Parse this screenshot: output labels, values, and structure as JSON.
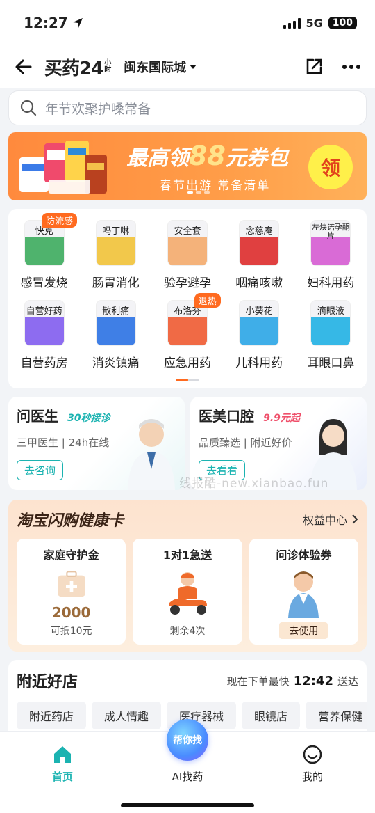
{
  "status": {
    "time": "12:27",
    "network": "5G",
    "battery": "100"
  },
  "nav": {
    "brand": "买药24",
    "brand_sub": "小时",
    "location": "闽东国际城"
  },
  "search": {
    "placeholder": "年节欢聚护嗓常备"
  },
  "banner": {
    "title_prefix": "最高领",
    "title_amount": "88",
    "title_suffix": "元券包",
    "subtitle": "春节出游 常备清单",
    "claim_label": "领"
  },
  "categories": [
    {
      "label": "感冒发烧",
      "icon_text": "快克",
      "tag": "防流感",
      "color": "#4fb36d"
    },
    {
      "label": "肠胃消化",
      "icon_text": "吗丁啉",
      "tag": "",
      "color": "#f2c84b"
    },
    {
      "label": "验孕避孕",
      "icon_text": "安全套",
      "tag": "",
      "color": "#f4b27a"
    },
    {
      "label": "咽痛咳嗽",
      "icon_text": "念慈庵",
      "tag": "",
      "color": "#e04040"
    },
    {
      "label": "妇科用药",
      "icon_text": "左炔诺孕酮片",
      "tag": "",
      "color": "#d96bd6"
    },
    {
      "label": "自营药房",
      "icon_text": "自营好药",
      "tag": "",
      "color": "#8d6cf0"
    },
    {
      "label": "消炎镇痛",
      "icon_text": "散利痛",
      "tag": "",
      "color": "#3f7fe6"
    },
    {
      "label": "应急用药",
      "icon_text": "布洛芬",
      "tag": "退热",
      "color": "#f06a45"
    },
    {
      "label": "儿科用药",
      "icon_text": "小葵花",
      "tag": "",
      "color": "#3faee8"
    },
    {
      "label": "耳眼口鼻",
      "icon_text": "滴眼液",
      "tag": "",
      "color": "#36b8e6"
    }
  ],
  "doctor": {
    "title": "问医生",
    "tag": "30秒接诊",
    "subtitle_a": "三甲医生",
    "subtitle_b": "24h在线",
    "button": "去咨询"
  },
  "aesthetic": {
    "title": "医美口腔",
    "tag": "9.9元起",
    "subtitle_a": "品质臻选",
    "subtitle_b": "附近好价",
    "button": "去看看"
  },
  "watermark": "线报酷-new.xianbao.fun",
  "health_card": {
    "title": "淘宝闪购健康卡",
    "link": "权益中心",
    "cards": [
      {
        "title": "家庭守护金",
        "amount": "2000",
        "foot": "可抵10元",
        "button": ""
      },
      {
        "title": "1对1急送",
        "amount": "",
        "foot": "剩余4次",
        "button": ""
      },
      {
        "title": "问诊体验券",
        "amount": "",
        "foot": "",
        "button": "去使用"
      }
    ]
  },
  "nearby": {
    "title": "附近好店",
    "delivery_prefix": "现在下单最快",
    "delivery_time": "12:42",
    "delivery_suffix": "送达",
    "tabs": [
      "附近药店",
      "成人情趣",
      "医疗器械",
      "眼镜店",
      "营养保健"
    ]
  },
  "tabbar": {
    "home": "首页",
    "ai_bubble": "帮你找",
    "ai": "AI找药",
    "mine": "我的"
  },
  "colors": {
    "accent": "#1bb3b1",
    "orange": "#ff6a1f",
    "text": "#222222"
  }
}
